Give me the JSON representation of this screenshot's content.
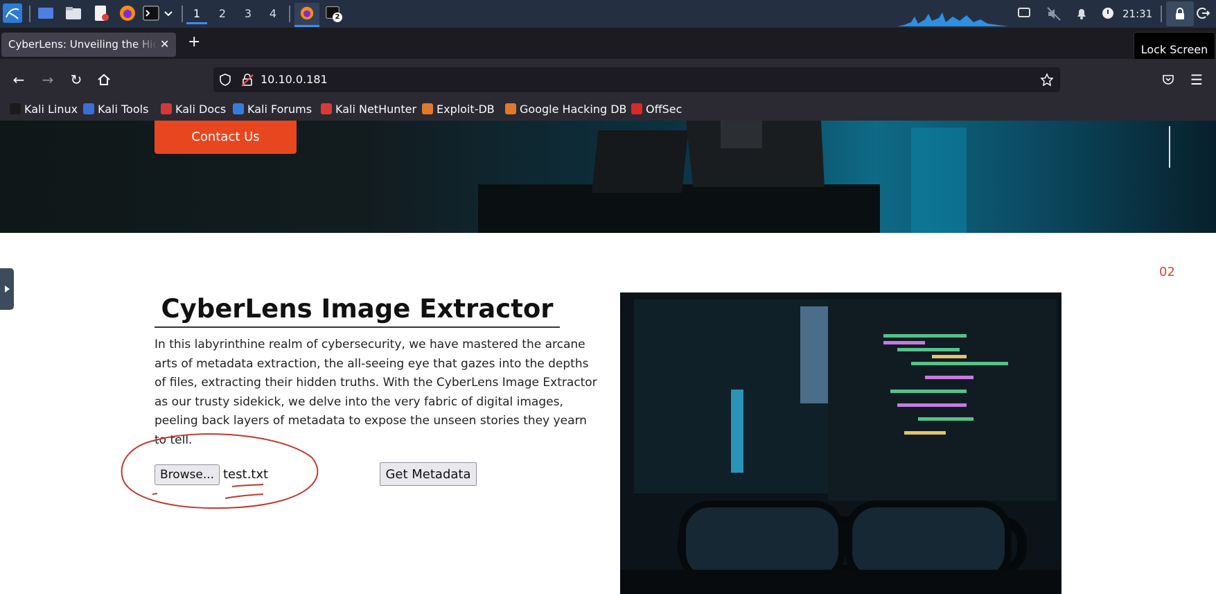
{
  "taskbar": {
    "workspaces": [
      "1",
      "2",
      "3",
      "4"
    ],
    "active_workspace": "1",
    "clock": "21:31",
    "terminal_badge": "2"
  },
  "browser": {
    "tab_title": "CyberLens: Unveiling the Hidden Matrix",
    "tooltip": "Lock Screen",
    "url": "10.10.0.181",
    "bookmarks": [
      {
        "label": "Kali Linux",
        "color": "#2f2f2f"
      },
      {
        "label": "Kali Tools",
        "color": "#3b6fd8"
      },
      {
        "label": "Kali Docs",
        "color": "#d23a3a"
      },
      {
        "label": "Kali Forums",
        "color": "#3a7bd8"
      },
      {
        "label": "Kali NetHunter",
        "color": "#d83a3a"
      },
      {
        "label": "Exploit-DB",
        "color": "#e07a2a"
      },
      {
        "label": "Google Hacking DB",
        "color": "#e07a2a"
      },
      {
        "label": "OffSec",
        "color": "#d82a2a"
      }
    ]
  },
  "page": {
    "contact_button": "Contact Us",
    "section_number": "02",
    "title": "CyberLens Image Extractor",
    "description": "In this labyrinthine realm of cybersecurity, we have mastered the arcane arts of metadata extraction, the all-seeing eye that gazes into the depths of files, extracting their hidden truths. With the CyberLens Image Extractor as our trusty sidekick, we delve into the very fabric of digital images, peeling back layers of metadata to expose the unseen stories they yearn to tell.",
    "browse_button": "Browse...",
    "selected_file": "test.txt",
    "get_metadata_button": "Get Metadata"
  },
  "colors": {
    "accent": "#e8461f",
    "annotation": "#c0392b"
  }
}
